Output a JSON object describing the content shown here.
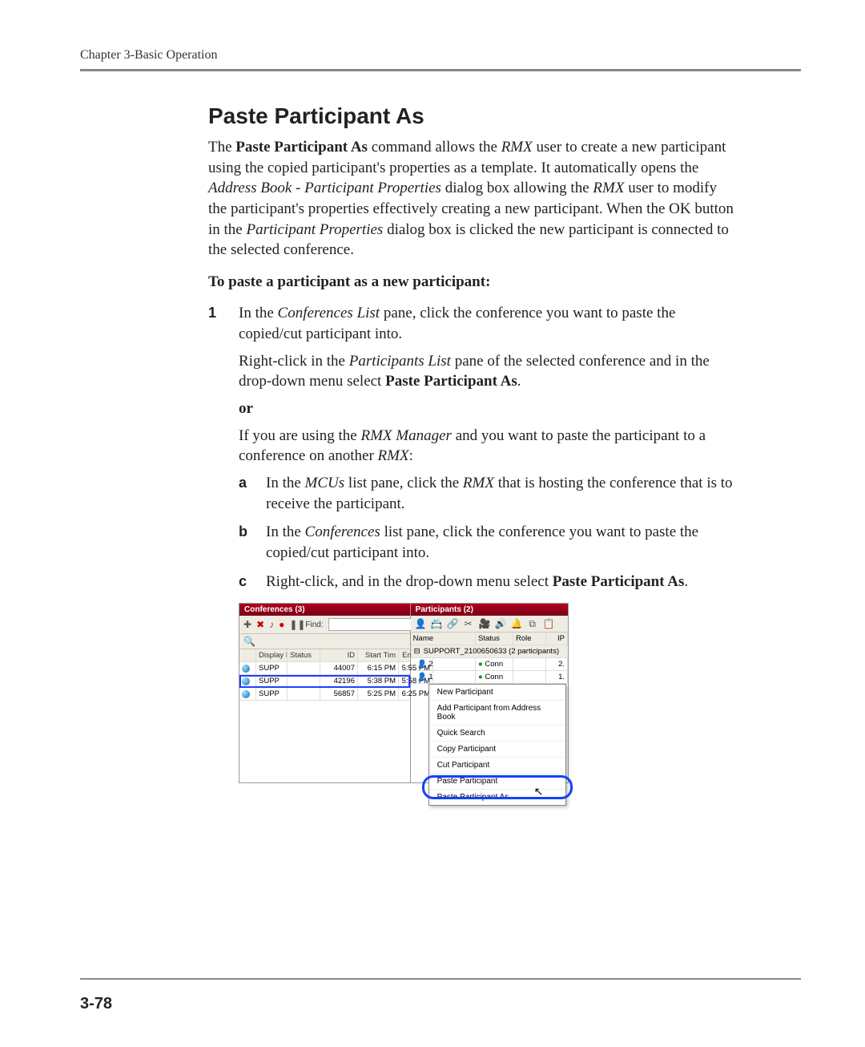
{
  "header": {
    "running": "Chapter 3-Basic Operation"
  },
  "title": "Paste Participant As",
  "para": {
    "p1_a": "The ",
    "p1_b": "Paste Participant As",
    "p1_c": " command allows the ",
    "p1_d": "RMX",
    "p1_e": " user to create a new participant using the copied participant's properties as a template. It automatically opens the ",
    "p1_f": "Address Book - Participant Properties",
    "p1_g": " dialog box allowing the ",
    "p1_h": "RMX",
    "p1_i": " user to modify the participant's properties effectively creating a new participant. When the OK button in the ",
    "p1_j": "Participant Properties",
    "p1_k": " dialog box is clicked the new participant is connected to the selected conference."
  },
  "lead": "To paste a participant as a new participant:",
  "step1": {
    "num": "1",
    "a1": "In the ",
    "a2": "Conferences List",
    "a3": " pane, click the conference you want to paste the copied/cut participant into.",
    "b1": "Right-click in the ",
    "b2": "Participants List",
    "b3": " pane of the selected conference and in the drop-down menu select ",
    "b4": "Paste Participant As",
    "b5": ".",
    "or": "or",
    "c1": "If you are using the ",
    "c2": "RMX Manager",
    "c3": " and you want to paste the participant to a conference on another ",
    "c4": "RMX",
    "c5": ":"
  },
  "sub": {
    "a": {
      "l": "a",
      "t1": "In the ",
      "t2": "MCUs",
      "t3": " list pane, click the ",
      "t4": "RMX",
      "t5": " that is hosting the conference that is to receive the participant."
    },
    "b": {
      "l": "b",
      "t1": "In the ",
      "t2": "Conferences",
      "t3": " list pane, click the conference you want to paste the copied/cut participant into."
    },
    "c": {
      "l": "c",
      "t1": "Right-click, and in the drop-down menu select ",
      "t2": "Paste Participant As",
      "t3": "."
    }
  },
  "fig": {
    "confs_title": "Conferences (3)",
    "parts_title": "Participants (2)",
    "find_label": "Find:",
    "conf_cols": {
      "disp": "Display N",
      "status": "Status",
      "id": "ID",
      "st": "Start Tim",
      "et": "End Tim"
    },
    "confs": [
      {
        "name": "SUPP",
        "id": "44007",
        "st": "6:15 PM",
        "et": "5:55 PM"
      },
      {
        "name": "SUPP",
        "id": "42196",
        "st": "5:38 PM",
        "et": "5:58 PM",
        "selected": true
      },
      {
        "name": "SUPP",
        "id": "56857",
        "st": "5:25 PM",
        "et": "6:25 PM"
      }
    ],
    "part_cols": {
      "name": "Name",
      "status": "Status",
      "role": "Role",
      "ip": "IP"
    },
    "part_group": "SUPPORT_2100650633 (2 participants)",
    "parts": [
      {
        "name": "2",
        "status": "Conn",
        "ip": "2."
      },
      {
        "name": "1",
        "status": "Conn",
        "ip": "1."
      }
    ],
    "ctx": [
      "New Participant",
      "Add Participant from Address Book",
      "Quick Search",
      "Copy Participant",
      "Cut Participant",
      "Paste Participant",
      "Paste Participant As"
    ]
  },
  "pagenum": "3-78"
}
